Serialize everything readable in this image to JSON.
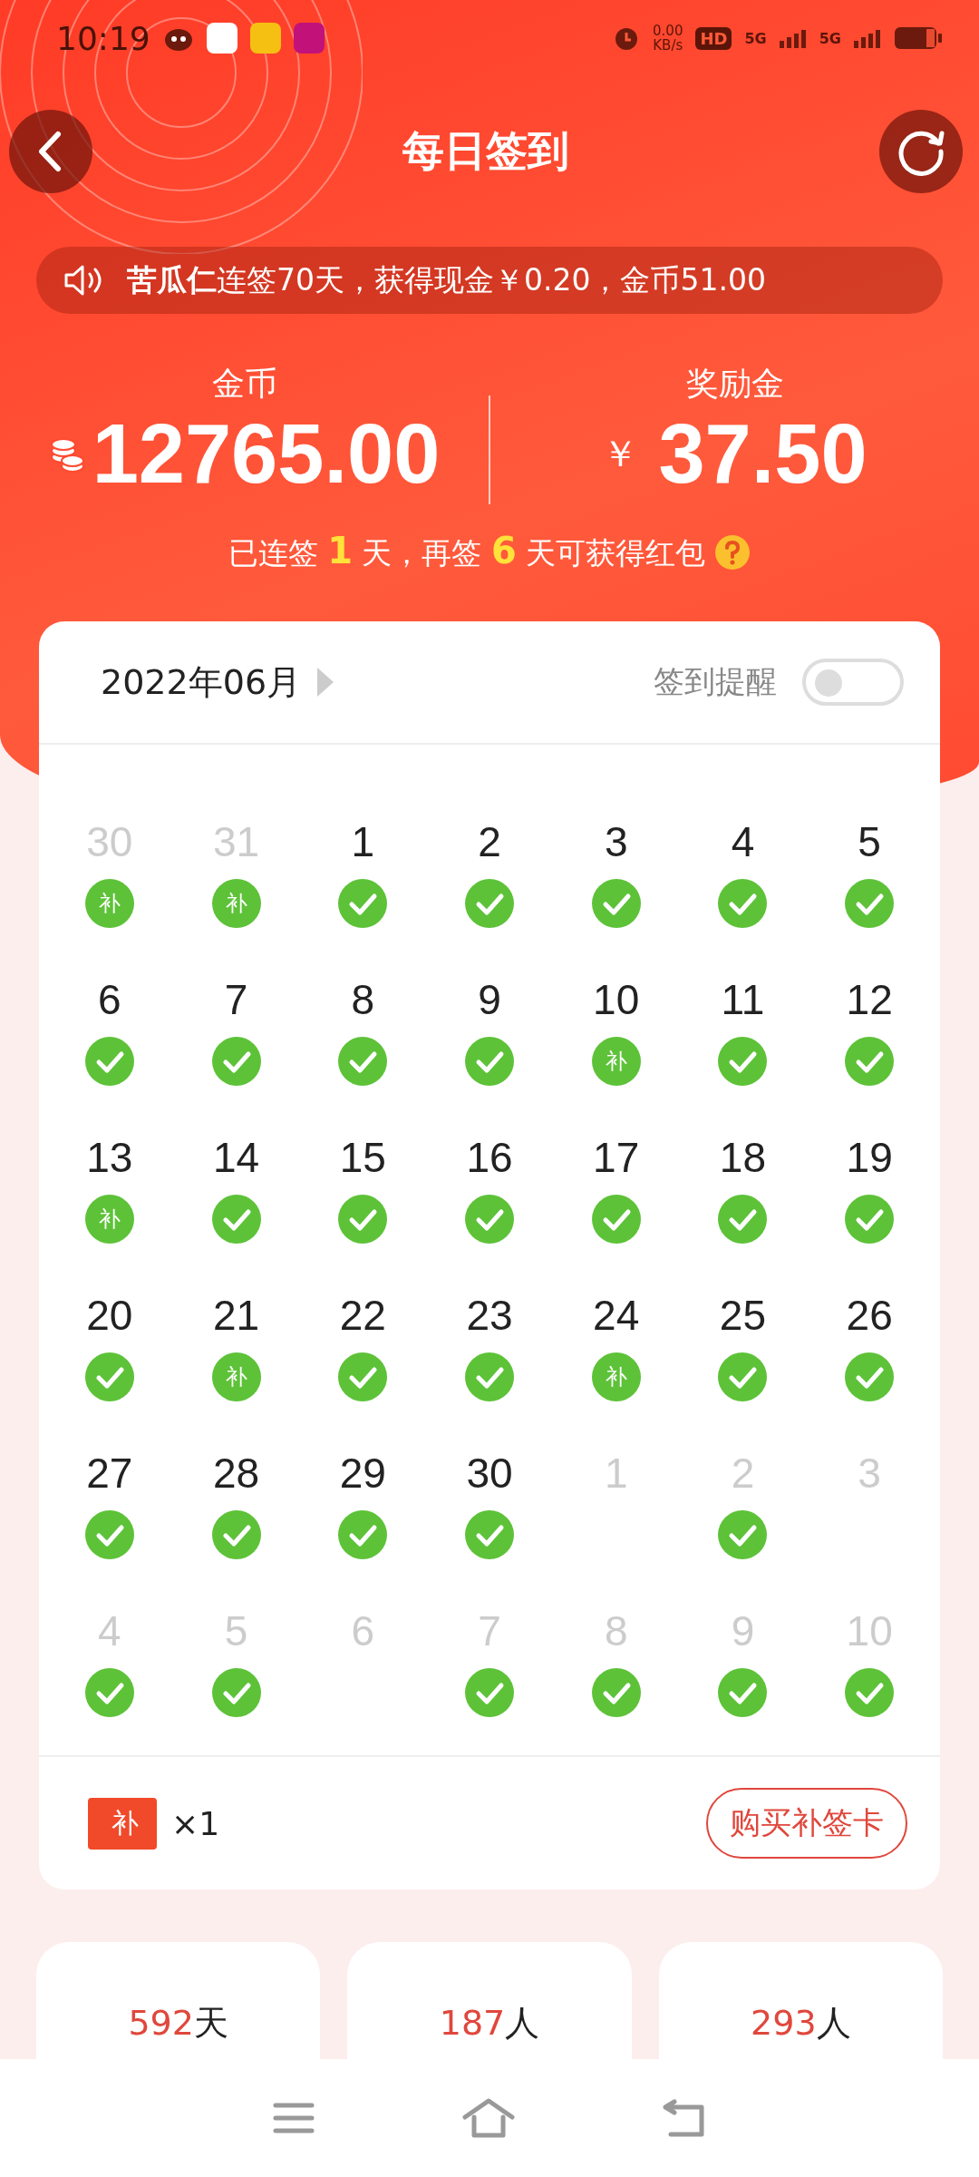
{
  "status_bar": {
    "time": "10:19",
    "speed_value": "0.00",
    "speed_unit": "KB/s",
    "hd": "HD",
    "network_1": "5G",
    "network_2": "5G"
  },
  "header": {
    "title": "每日签到"
  },
  "notice": "**苦瓜仁**连签70天，获得现金￥0.20，金币51.00",
  "balances": [
    {
      "kind": "coins",
      "label": "金币",
      "value": "12765.00"
    },
    {
      "kind": "cash",
      "label": "奖励金",
      "currency": "￥",
      "value": "37.50"
    }
  ],
  "streak": {
    "prefix": "已连签",
    "days": "1",
    "middle": "天，再签",
    "remaining": "6",
    "suffix": "天可获得红包"
  },
  "calendar": {
    "month": "2022年06月",
    "reminder_label": "签到提醒",
    "reminder_on": false,
    "weeks": [
      [
        {
          "day": "30",
          "muted": true,
          "kind": "makeup",
          "label": "补"
        },
        {
          "day": "31",
          "muted": true,
          "kind": "makeup",
          "label": "补"
        },
        {
          "day": "1",
          "muted": false,
          "kind": "check"
        },
        {
          "day": "2",
          "muted": false,
          "kind": "check"
        },
        {
          "day": "3",
          "muted": false,
          "kind": "check"
        },
        {
          "day": "4",
          "muted": false,
          "kind": "check"
        },
        {
          "day": "5",
          "muted": false,
          "kind": "check"
        }
      ],
      [
        {
          "day": "6",
          "muted": false,
          "kind": "check"
        },
        {
          "day": "7",
          "muted": false,
          "kind": "check"
        },
        {
          "day": "8",
          "muted": false,
          "kind": "check"
        },
        {
          "day": "9",
          "muted": false,
          "kind": "check"
        },
        {
          "day": "10",
          "muted": false,
          "kind": "makeup",
          "label": "补"
        },
        {
          "day": "11",
          "muted": false,
          "kind": "check"
        },
        {
          "day": "12",
          "muted": false,
          "kind": "check"
        }
      ],
      [
        {
          "day": "13",
          "muted": false,
          "kind": "makeup",
          "label": "补"
        },
        {
          "day": "14",
          "muted": false,
          "kind": "check"
        },
        {
          "day": "15",
          "muted": false,
          "kind": "check"
        },
        {
          "day": "16",
          "muted": false,
          "kind": "check"
        },
        {
          "day": "17",
          "muted": false,
          "kind": "check"
        },
        {
          "day": "18",
          "muted": false,
          "kind": "check"
        },
        {
          "day": "19",
          "muted": false,
          "kind": "check"
        }
      ],
      [
        {
          "day": "20",
          "muted": false,
          "kind": "check"
        },
        {
          "day": "21",
          "muted": false,
          "kind": "makeup",
          "label": "补"
        },
        {
          "day": "22",
          "muted": false,
          "kind": "check"
        },
        {
          "day": "23",
          "muted": false,
          "kind": "check"
        },
        {
          "day": "24",
          "muted": false,
          "kind": "makeup",
          "label": "补"
        },
        {
          "day": "25",
          "muted": false,
          "kind": "check"
        },
        {
          "day": "26",
          "muted": false,
          "kind": "check"
        }
      ],
      [
        {
          "day": "27",
          "muted": false,
          "kind": "check"
        },
        {
          "day": "28",
          "muted": false,
          "kind": "check"
        },
        {
          "day": "29",
          "muted": false,
          "kind": "check"
        },
        {
          "day": "30",
          "muted": false,
          "kind": "check"
        },
        {
          "day": "1",
          "muted": true,
          "kind": "empty"
        },
        {
          "day": "2",
          "muted": true,
          "kind": "check"
        },
        {
          "day": "3",
          "muted": true,
          "kind": "empty"
        }
      ],
      [
        {
          "day": "4",
          "muted": true,
          "kind": "check"
        },
        {
          "day": "5",
          "muted": true,
          "kind": "check"
        },
        {
          "day": "6",
          "muted": true,
          "kind": "empty"
        },
        {
          "day": "7",
          "muted": true,
          "kind": "check"
        },
        {
          "day": "8",
          "muted": true,
          "kind": "check"
        },
        {
          "day": "9",
          "muted": true,
          "kind": "check"
        },
        {
          "day": "10",
          "muted": true,
          "kind": "check"
        }
      ]
    ]
  },
  "makeup_card": {
    "badge": "补",
    "count": "×1",
    "buy_button": "购买补签卡"
  },
  "stats": [
    {
      "value": "592",
      "unit": "天"
    },
    {
      "value": "187",
      "unit": "人"
    },
    {
      "value": "293",
      "unit": "人"
    }
  ]
}
